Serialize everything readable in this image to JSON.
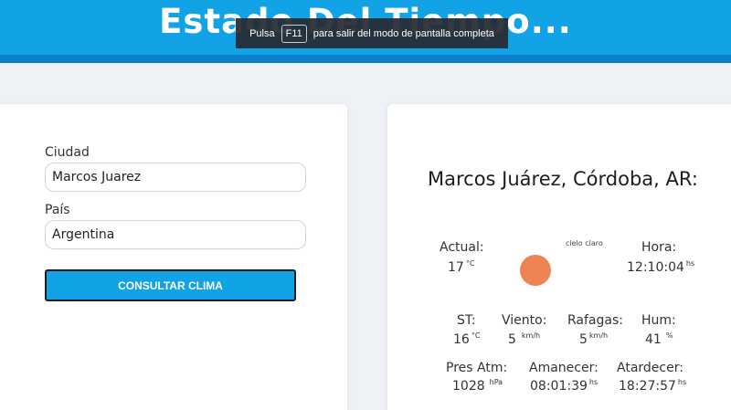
{
  "header": {
    "title": "Estado Del Tiempo...",
    "color": "#12a2e6"
  },
  "fullscreen_notice": {
    "prefix": "Pulsa",
    "key": "F11",
    "suffix": "para salir del modo de pantalla completa"
  },
  "form": {
    "city_label": "Ciudad",
    "city_value": "Marcos Juarez",
    "country_label": "País",
    "country_value": "Argentina",
    "submit_label": "CONSULTAR CLIMA"
  },
  "weather": {
    "location": "Marcos Juárez, Córdoba, AR:",
    "description": "cielo claro",
    "icon": "sun-icon",
    "current_label": "Actual:",
    "current_value": "17",
    "current_unit": "°C",
    "time_label": "Hora:",
    "time_value": "12:10:04",
    "time_unit": "hs",
    "st_label": "ST:",
    "st_value": "16",
    "st_unit": "°C",
    "wind_label": "Viento:",
    "wind_value": "5",
    "wind_unit": "km/h",
    "gusts_label": "Rafagas:",
    "gusts_value": "5",
    "gusts_unit": "km/h",
    "humidity_label": "Hum:",
    "humidity_value": "41",
    "humidity_unit": "%",
    "pressure_label": "Pres Atm:",
    "pressure_value": "1028",
    "pressure_unit": "hPa",
    "sunrise_label": "Amanecer:",
    "sunrise_value": "08:01:39",
    "sunrise_unit": "hs",
    "sunset_label": "Atardecer:",
    "sunset_value": "18:27:57",
    "sunset_unit": "hs"
  }
}
